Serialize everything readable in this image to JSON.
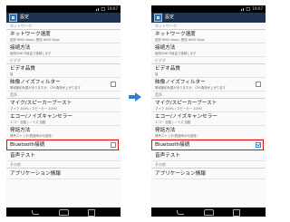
{
  "status_time": "19:07",
  "app_title": "設定",
  "left": {
    "items": [
      {
        "kind": "cat",
        "title": "ネットワーク"
      },
      {
        "kind": "row",
        "title": "ネットワーク速度",
        "sub": "送信 6000 kbps / 受信 6000 kbps"
      },
      {
        "kind": "row",
        "title": "接続方法",
        "sub": "使用のWi-Fi経由で接続します"
      },
      {
        "kind": "cat",
        "title": "ビデオ"
      },
      {
        "kind": "row",
        "title": "ビデオ品質",
        "sub": "高"
      },
      {
        "kind": "row",
        "title": "映像ノイズフィルター",
        "sub": "帯域節約効果がありますが、CPU負荷が上がります",
        "checkbox": false
      },
      {
        "kind": "cat",
        "title": "音声"
      },
      {
        "kind": "row",
        "title": "マイク/スピーカーブースト",
        "sub": "マイク 100% / スピーカー 100%"
      },
      {
        "kind": "row",
        "title": "エコー/ノイズキャンセラー",
        "sub": "エコー 自動 / ノイズ 自動"
      },
      {
        "kind": "row",
        "title": "発話方法",
        "sub": "音声スイッチ(発話時のみ送信)"
      },
      {
        "kind": "row",
        "title": "Bluetooth接続",
        "sub": "",
        "checkbox": false,
        "highlight": true
      },
      {
        "kind": "row",
        "title": "音声テスト",
        "sub": ""
      },
      {
        "kind": "cat",
        "title": "その他"
      },
      {
        "kind": "row",
        "title": "アプリケーション情報",
        "sub": ""
      }
    ]
  },
  "right": {
    "items": [
      {
        "kind": "cat",
        "title": "ネットワーク"
      },
      {
        "kind": "row",
        "title": "ネットワーク速度",
        "sub": "送信 6000 kbps / 受信 6000 kbps"
      },
      {
        "kind": "row",
        "title": "接続方法",
        "sub": "使用のWi-Fi経由で接続します"
      },
      {
        "kind": "cat",
        "title": "ビデオ"
      },
      {
        "kind": "row",
        "title": "ビデオ品質",
        "sub": "高"
      },
      {
        "kind": "row",
        "title": "映像ノイズフィルター",
        "sub": "帯域節約効果がありますが、CPU負荷が上がります",
        "checkbox": false
      },
      {
        "kind": "cat",
        "title": "音声"
      },
      {
        "kind": "row",
        "title": "マイク/スピーカーブースト",
        "sub": "マイク 100% / スピーカー 100%"
      },
      {
        "kind": "row",
        "title": "エコー/ノイズキャンセラー",
        "sub": "エコー 自動 / ノイズ 自動"
      },
      {
        "kind": "row",
        "title": "発話方法",
        "sub": "音声スイッチ(発話時のみ送信)"
      },
      {
        "kind": "row",
        "title": "Bluetooth接続",
        "sub": "",
        "checkbox": true,
        "highlight": true
      },
      {
        "kind": "row",
        "title": "音声テスト",
        "sub": ""
      },
      {
        "kind": "cat",
        "title": "その他"
      },
      {
        "kind": "row",
        "title": "アプリケーション情報",
        "sub": ""
      }
    ]
  },
  "colors": {
    "action_bar": "#1f3350",
    "highlight": "#e10a17",
    "arrow": "#2f7fd8"
  }
}
